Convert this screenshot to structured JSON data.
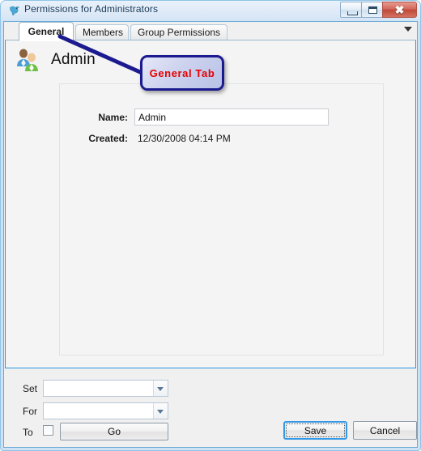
{
  "window": {
    "title": "Permissions for Administrators",
    "icon": "bird-icon",
    "controls": {
      "minimize": "minimize-icon",
      "maximize": "maximize-icon",
      "close": "✖"
    }
  },
  "tabs": {
    "items": [
      {
        "label": "General",
        "active": true
      },
      {
        "label": "Members",
        "active": false
      },
      {
        "label": "Group Permissions",
        "active": false
      }
    ],
    "overflow_icon": "chevron-down-icon"
  },
  "general_tab": {
    "heading": "Admin",
    "heading_icon": "users-group-icon",
    "fields": [
      {
        "label": "Name:",
        "value": "Admin",
        "type": "text"
      },
      {
        "label": "Created:",
        "value": "12/30/2008 04:14 PM",
        "type": "static"
      }
    ]
  },
  "annotation": {
    "text": "General Tab",
    "text_color": "#e60000",
    "border_color": "#1b1b8f"
  },
  "bottom_bar": {
    "rows": [
      {
        "label": "Set",
        "value": "",
        "placeholder": ""
      },
      {
        "label": "For",
        "value": "",
        "placeholder": ""
      }
    ],
    "to_label": "To",
    "to_checked": false,
    "go_label": "Go",
    "save_label": "Save",
    "cancel_label": "Cancel"
  }
}
